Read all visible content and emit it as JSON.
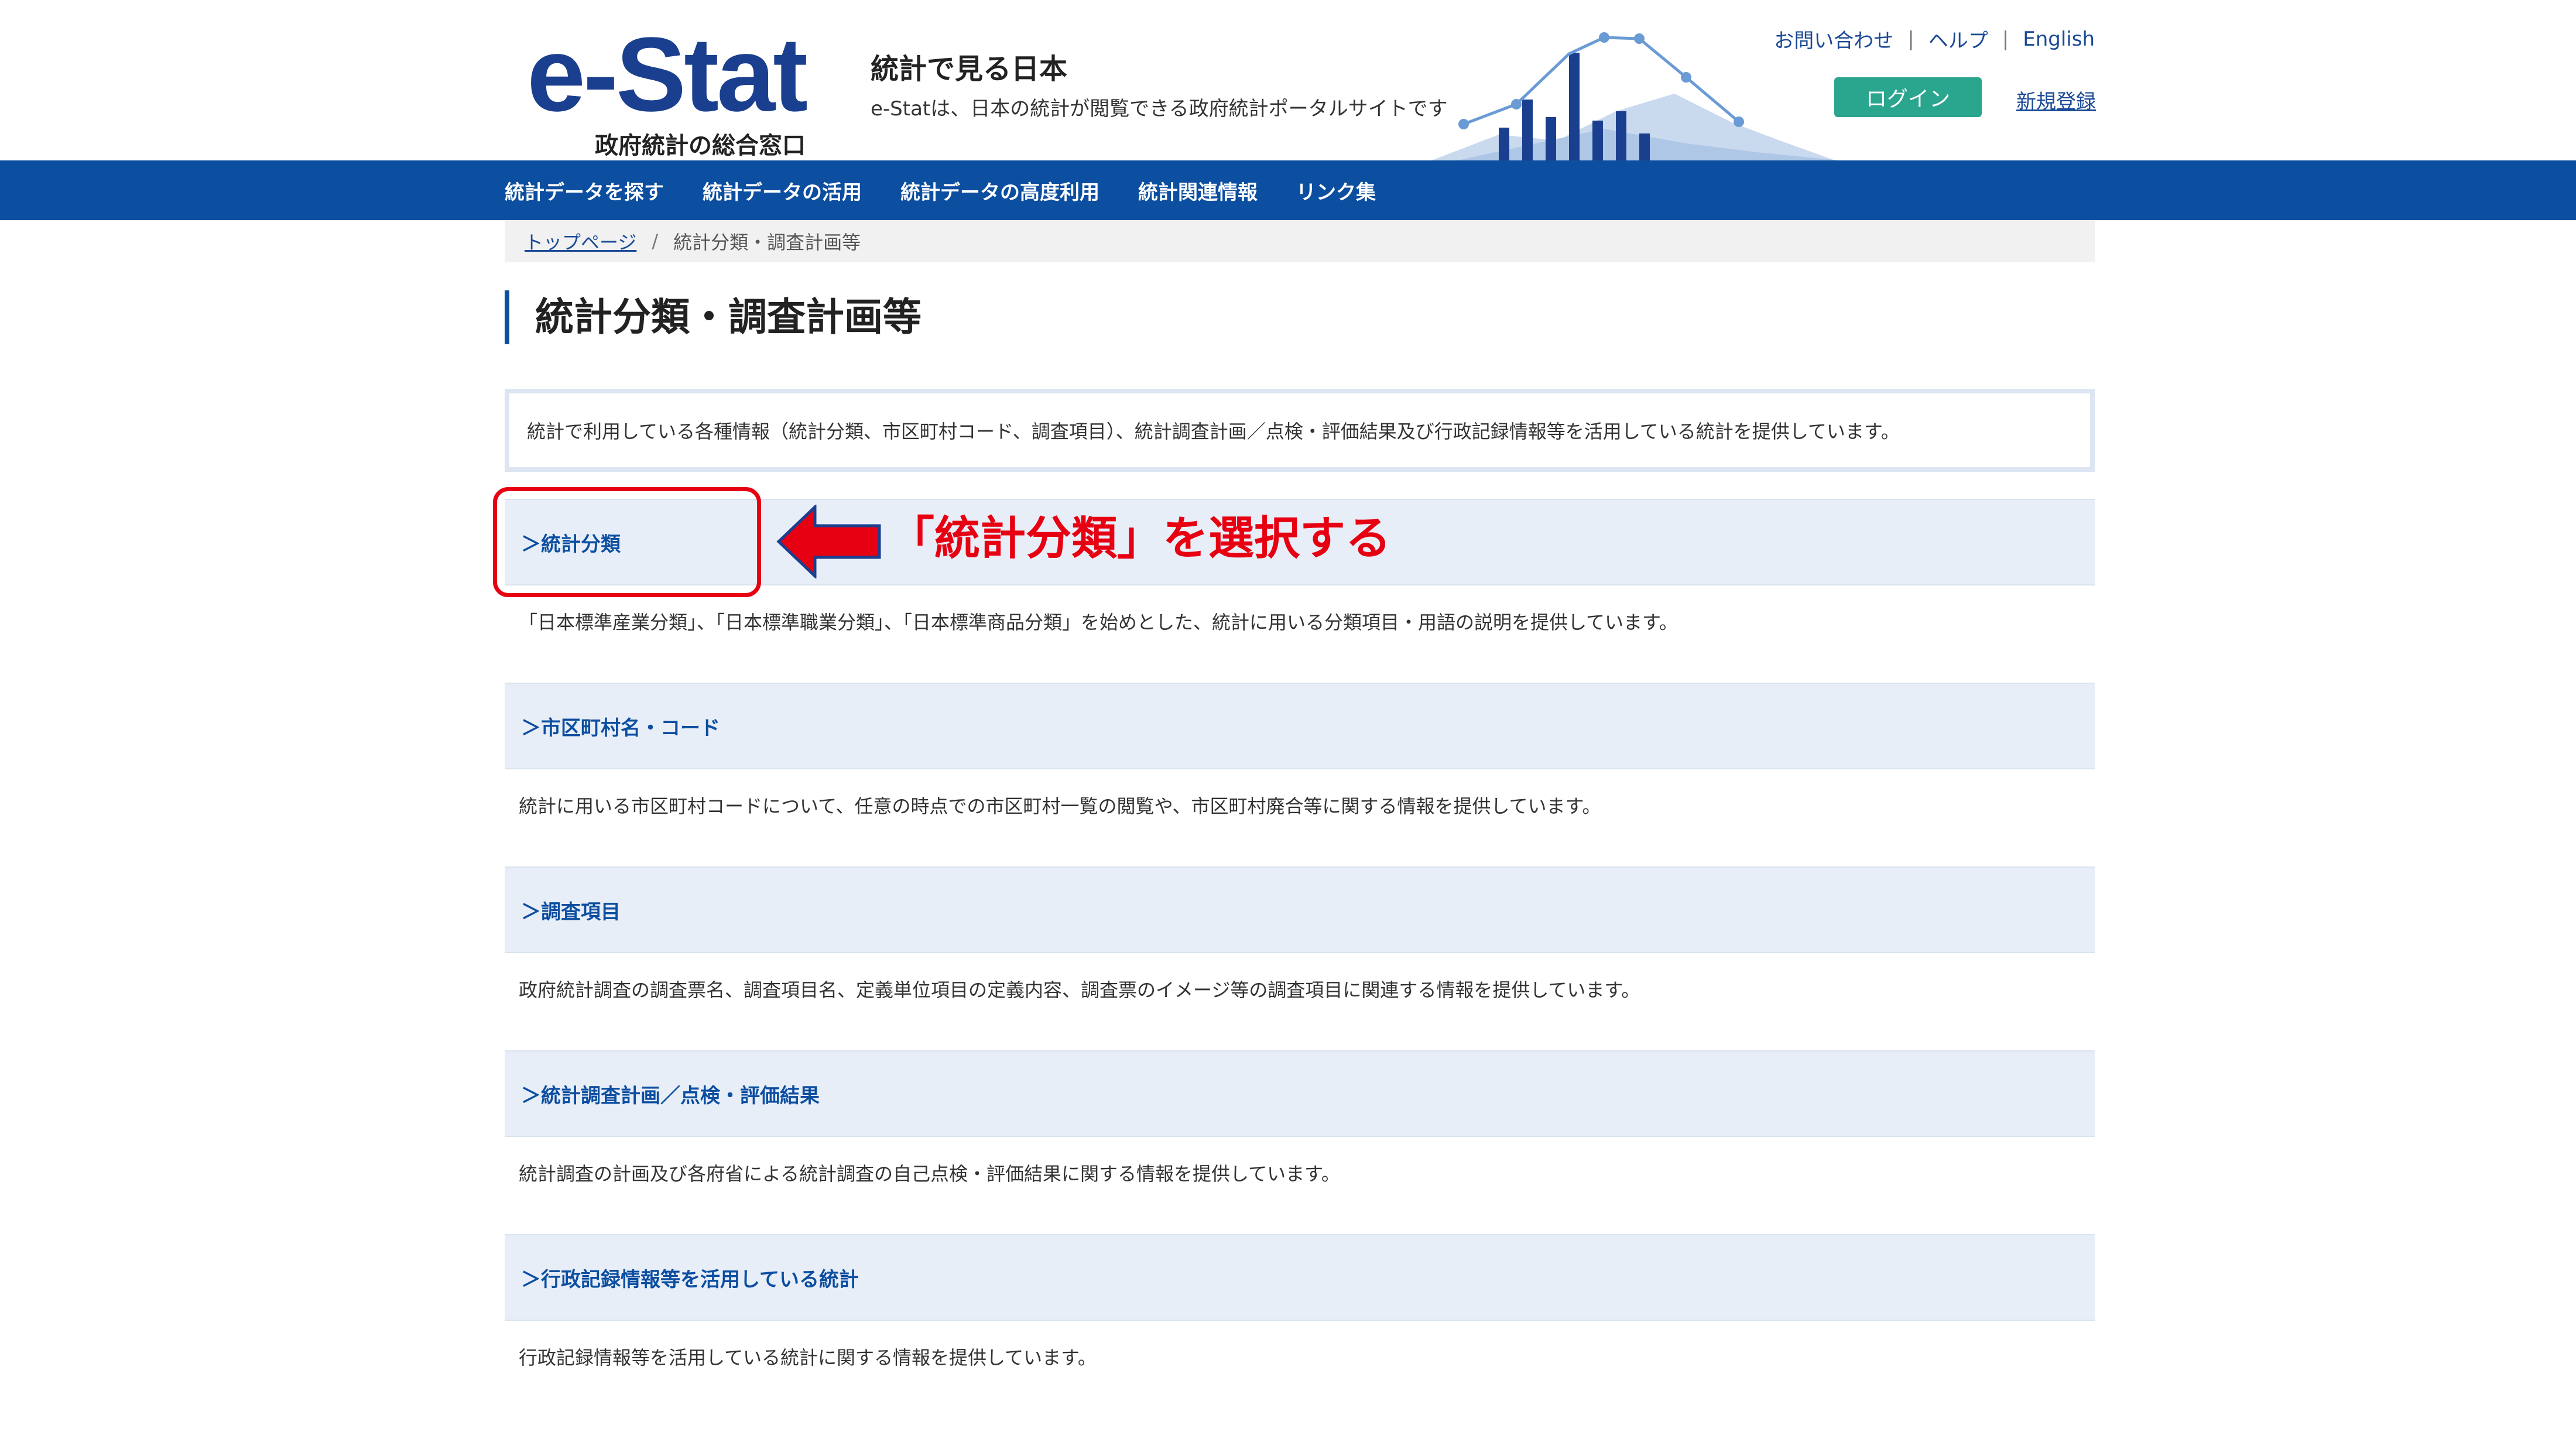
{
  "header": {
    "logo_text": "e-Stat",
    "logo_subtitle": "政府統計の総合窓口",
    "site_title": "統計で見る日本",
    "site_description": "e-Statは、日本の統計が閲覧できる政府統計ポータルサイトです",
    "links": {
      "contact": "お問い合わせ",
      "help": "ヘルプ",
      "english": "English",
      "separator": "|"
    },
    "login_label": "ログイン",
    "register_label": "新規登録"
  },
  "nav": {
    "items": [
      {
        "label": "統計データを探す"
      },
      {
        "label": "統計データの活用"
      },
      {
        "label": "統計データの高度利用"
      },
      {
        "label": "統計関連情報"
      },
      {
        "label": "リンク集"
      }
    ]
  },
  "breadcrumb": {
    "home": "トップページ",
    "separator": "/",
    "current": "統計分類・調査計画等"
  },
  "page_title": "統計分類・調査計画等",
  "intro": "統計で利用している各種情報（統計分類、市区町村コード、調査項目）、統計調査計画／点検・評価結果及び行政記録情報等を活用している統計を提供しています。",
  "sections": [
    {
      "label": "＞統計分類",
      "description": "「日本標準産業分類」、「日本標準職業分類」、「日本標準商品分類」を始めとした、統計に用いる分類項目・用語の説明を提供しています。"
    },
    {
      "label": "＞市区町村名・コード",
      "description": "統計に用いる市区町村コードについて、任意の時点での市区町村一覧の閲覧や、市区町村廃合等に関する情報を提供しています。"
    },
    {
      "label": "＞調査項目",
      "description": "政府統計調査の調査票名、調査項目名、定義単位項目の定義内容、調査票のイメージ等の調査項目に関連する情報を提供しています。"
    },
    {
      "label": "＞統計調査計画／点検・評価結果",
      "description": "統計調査の計画及び各府省による統計調査の自己点検・評価結果に関する情報を提供しています。"
    },
    {
      "label": "＞行政記録情報等を活用している統計",
      "description": "行政記録情報等を活用している統計に関する情報を提供しています。"
    }
  ],
  "annotation": {
    "text": "「統計分類」を選択する",
    "color": "#e60012"
  },
  "colors": {
    "brand_blue": "#0c4ea0",
    "logo_blue": "#1b3f8f",
    "login_green": "#2aa58e",
    "section_bg": "#e8eef8"
  }
}
